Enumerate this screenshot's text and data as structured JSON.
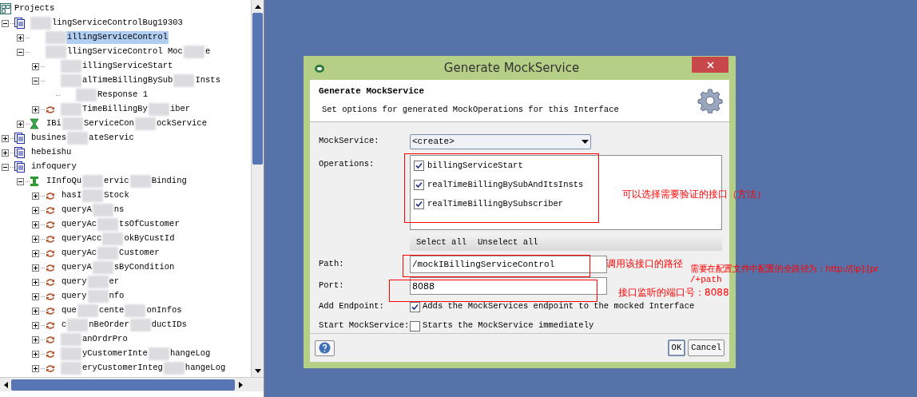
{
  "tree": {
    "label": "Projects",
    "children": [
      {
        "fragments": [
          "lingServiceControlBug19303"
        ],
        "redacted_start": true,
        "kind": "project",
        "expanded": true,
        "selected": false,
        "children": [
          {
            "fragments": [
              "illingServiceControl"
            ],
            "redacted_start": true,
            "kind": "plain",
            "expanded": false,
            "selected": true
          },
          {
            "fragments": [
              "llingServiceControl Moc",
              "e"
            ],
            "redacted_start": true,
            "kind": "plain",
            "expanded": true,
            "selected": false,
            "children": [
              {
                "fragments": [
                  "illingServiceStart"
                ],
                "redacted_start": true,
                "kind": "plain",
                "expanded": false,
                "selected": false
              },
              {
                "fragments": [
                  "alTimeBillingBySub",
                  "Insts"
                ],
                "redacted_start": true,
                "kind": "plain",
                "expanded": true,
                "selected": false,
                "children": [
                  {
                    "fragments": [
                      "Response 1"
                    ],
                    "redacted_start": true,
                    "selected": false
                  }
                ]
              },
              {
                "fragments": [
                  "TimeBillingBy",
                  "iber"
                ],
                "redacted_start": true,
                "kind": "operation",
                "expanded": false,
                "selected": false
              }
            ]
          },
          {
            "fragments": [
              "IBi",
              "ServiceCon",
              "ockService"
            ],
            "redacted_start": false,
            "kind": "mock",
            "expanded": false,
            "selected": false
          }
        ]
      },
      {
        "fragments": [
          "busines",
          "ateServic"
        ],
        "redacted_start": false,
        "kind": "project",
        "expanded": false,
        "selected": false
      },
      {
        "fragments": [
          "hebeishu"
        ],
        "redacted_start": false,
        "kind": "project",
        "expanded": false,
        "selected": false
      },
      {
        "fragments": [
          "infoquery"
        ],
        "redacted_start": false,
        "kind": "project",
        "expanded": true,
        "selected": false,
        "children": [
          {
            "fragments": [
              "IInfoQu",
              "ervic",
              "Binding"
            ],
            "redacted_start": false,
            "kind": "interface",
            "expanded": true,
            "selected": false,
            "children": [
              {
                "fragments": [
                  "hasI",
                  "Stock"
                ],
                "redacted_start": false,
                "kind": "operation",
                "expanded": false,
                "selected": false
              },
              {
                "fragments": [
                  "queryA",
                  "ns"
                ],
                "redacted_start": false,
                "kind": "operation",
                "expanded": false,
                "selected": false
              },
              {
                "fragments": [
                  "queryAc",
                  "tsOfCustomer"
                ],
                "redacted_start": false,
                "kind": "operation",
                "expanded": false,
                "selected": false
              },
              {
                "fragments": [
                  "queryAcc",
                  "okByCustId"
                ],
                "redacted_start": false,
                "kind": "operation",
                "expanded": false,
                "selected": false
              },
              {
                "fragments": [
                  "queryAc",
                  "Customer"
                ],
                "redacted_start": false,
                "kind": "operation",
                "expanded": false,
                "selected": false
              },
              {
                "fragments": [
                  "queryA",
                  "sByCondition"
                ],
                "redacted_start": false,
                "kind": "operation",
                "expanded": false,
                "selected": false
              },
              {
                "fragments": [
                  "query",
                  "er"
                ],
                "redacted_start": false,
                "kind": "operation",
                "expanded": false,
                "selected": false
              },
              {
                "fragments": [
                  "query",
                  "nfo"
                ],
                "redacted_start": false,
                "kind": "operation",
                "expanded": false,
                "selected": false
              },
              {
                "fragments": [
                  "que",
                  "cente",
                  "onInfos"
                ],
                "redacted_start": false,
                "kind": "operation",
                "expanded": false,
                "selected": false
              },
              {
                "fragments": [
                  "c",
                  "nBeOrder",
                  "ductIDs"
                ],
                "redacted_start": false,
                "kind": "operation",
                "expanded": false,
                "selected": false
              },
              {
                "fragments": [
                  "anOrdrPro"
                ],
                "redacted_start": true,
                "kind": "operation",
                "expanded": false,
                "selected": false
              },
              {
                "fragments": [
                  "yCustomerInte",
                  "hangeLog"
                ],
                "redacted_start": true,
                "kind": "operation",
                "expanded": false,
                "selected": false
              },
              {
                "fragments": [
                  "eryCustomerInteg",
                  "hangeLog"
                ],
                "redacted_start": true,
                "kind": "operation",
                "expanded": false,
                "selected": false
              }
            ]
          }
        ]
      }
    ]
  },
  "dialog": {
    "title": "Generate MockService",
    "heading": "Generate MockService",
    "subtitle": "Set options for generated MockOperations for this Interface",
    "mockservice": {
      "label": "MockService:",
      "value": "<create>"
    },
    "operations": {
      "label": "Operations:",
      "items": [
        {
          "label": "billingServiceStart",
          "checked": true
        },
        {
          "label": "realTimeBillingBySubAndItsInsts",
          "checked": true
        },
        {
          "label": "realTimeBillingBySubscriber",
          "checked": true
        }
      ]
    },
    "select_all": "Select all",
    "unselect_all": "Unselect all",
    "path": {
      "label": "Path:",
      "value": "/mockIBillingServiceControl"
    },
    "port": {
      "label": "Port:",
      "value": "8088"
    },
    "add_endpoint": {
      "label": "Add Endpoint:",
      "text": "Adds the MockServices endpoint to the mocked Interface",
      "checked": true
    },
    "start_mockservice": {
      "label": "Start MockService:",
      "text": "Starts the MockService immediately",
      "checked": false
    },
    "ok": "OK",
    "cancel": "Cancel"
  },
  "annotations": {
    "operations_note": "可以选择需要验证的接口（方法）",
    "path_note": "调用该接口的路径",
    "full_path_note": "需要在配置文件中配置的全路径为：http://[ip]:[pr",
    "full_path_note_2": "/+path",
    "port_note": "接口监听的端口号：8088"
  }
}
